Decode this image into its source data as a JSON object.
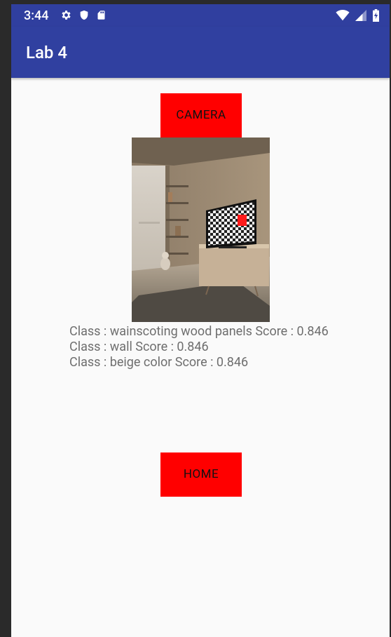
{
  "status_bar": {
    "time": "3:44"
  },
  "app_bar": {
    "title": "Lab 4"
  },
  "camera_button": {
    "label": "CAMERA"
  },
  "home_button": {
    "label": "HOME"
  },
  "results": [
    {
      "line": "Class : wainscoting wood panels Score : 0.846"
    },
    {
      "line": "Class : wall Score : 0.846"
    },
    {
      "line": "Class : beige color Score : 0.846"
    }
  ],
  "colors": {
    "primary": "#3040a0",
    "primary_dark": "#303f9f",
    "button": "#ff0000"
  }
}
